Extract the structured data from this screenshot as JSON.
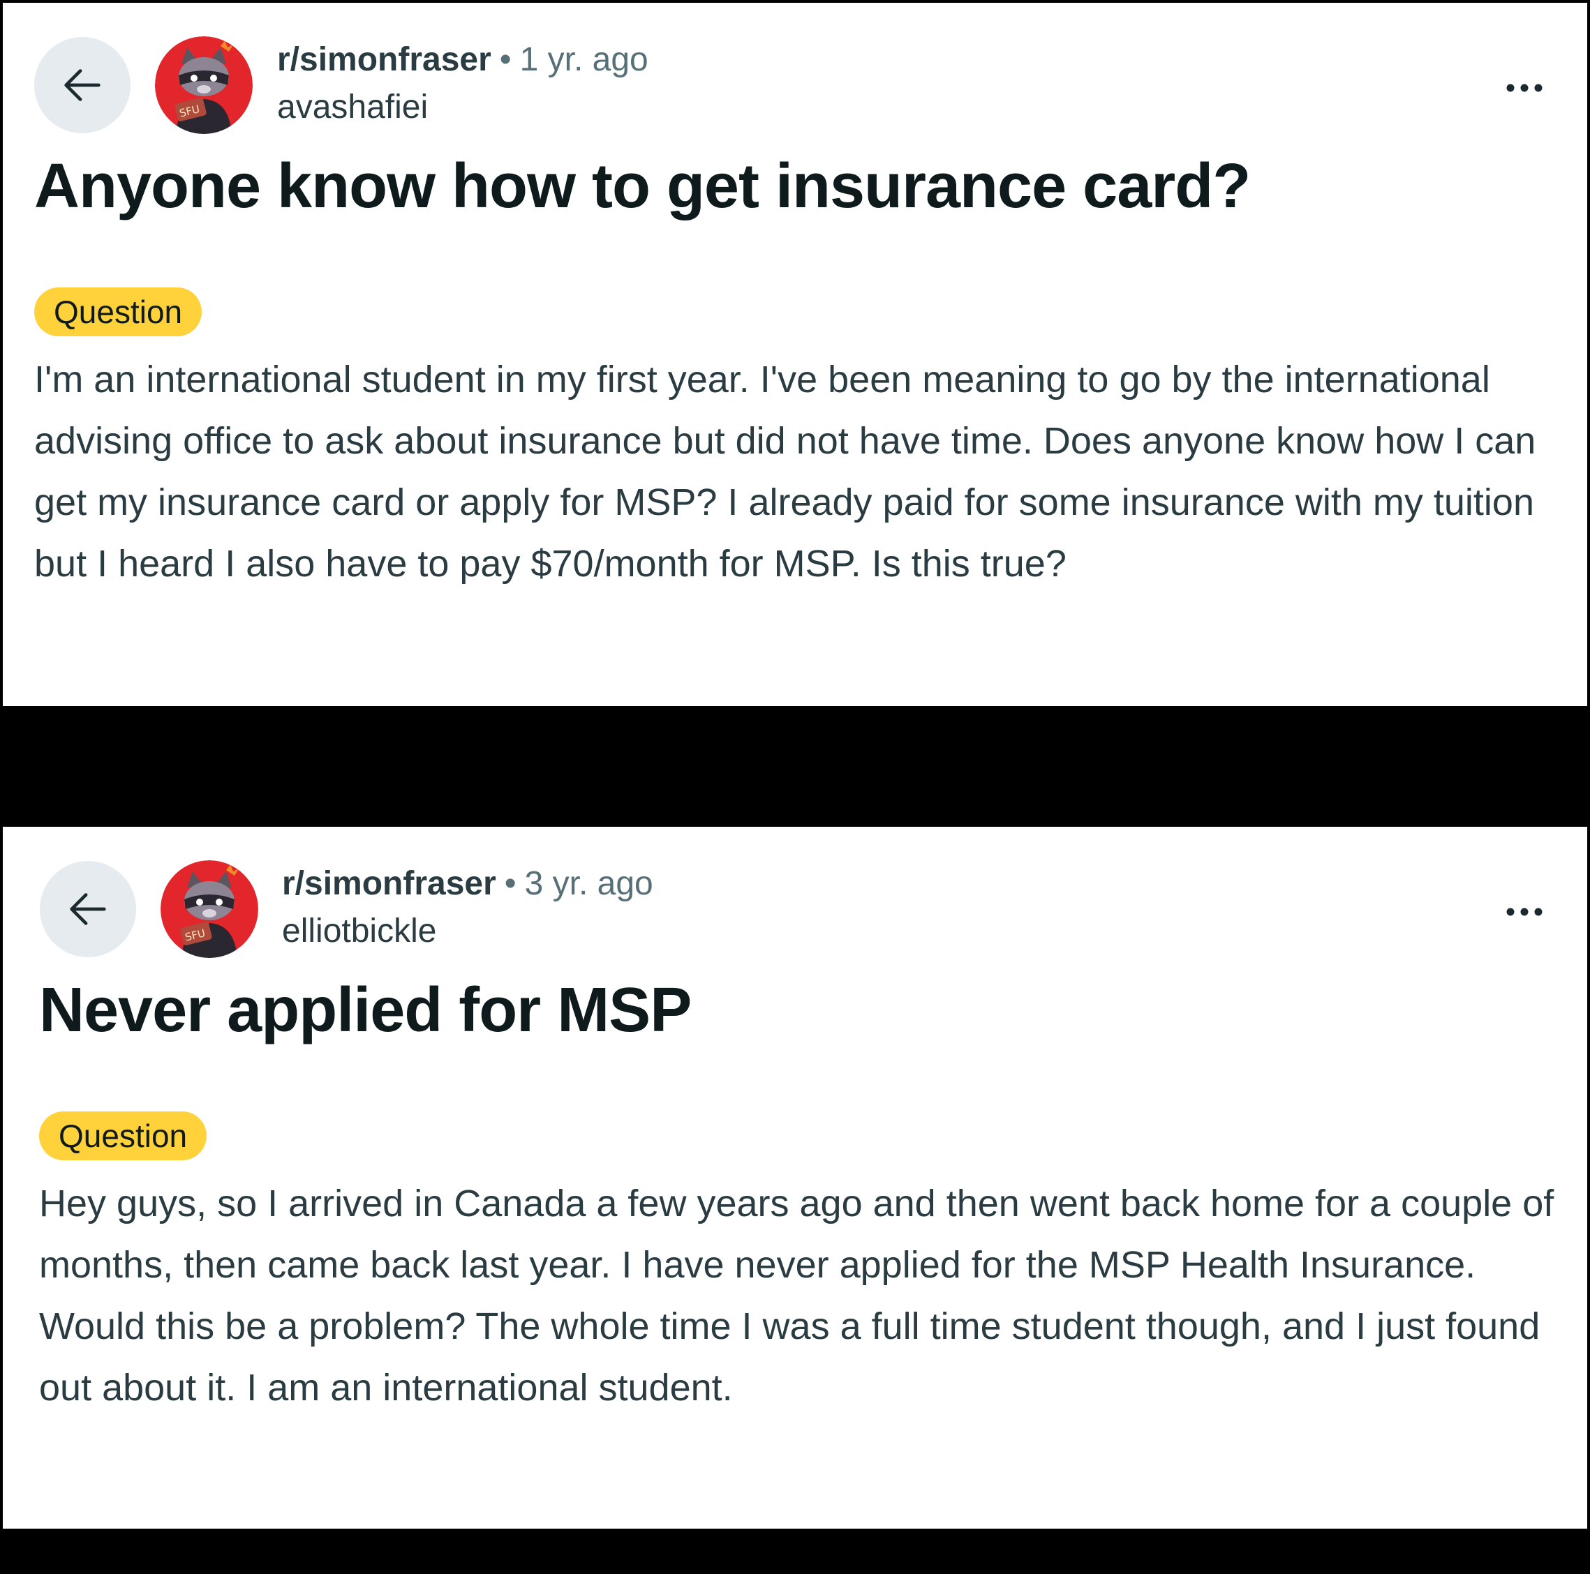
{
  "posts": [
    {
      "subreddit": "r/simonfraser",
      "separator": "•",
      "age": "1 yr. ago",
      "author": "avashafiei",
      "title": "Anyone know how to get insurance card?",
      "flair": "Question",
      "body": "I'm an international student in my first year. I've been meaning to go by the international advising office to ask about insurance but did not have time. Does anyone know how I can get my insurance card or apply for MSP? I already paid for some insurance with my tuition but I heard I also have to pay $70/month for MSP. Is this true?",
      "avatar_badge": "SFU",
      "icons": {
        "back": "arrow-left-icon",
        "more": "ellipsis-icon"
      }
    },
    {
      "subreddit": "r/simonfraser",
      "separator": "•",
      "age": "3 yr. ago",
      "author": "elliotbickle",
      "title": "Never applied for MSP",
      "flair": "Question",
      "body": "Hey guys, so I arrived in Canada a few years ago and then went back home for a couple of months, then came back last year. I have never applied for the MSP Health Insurance. Would this be a problem? The whole time I was a full time student though, and I just found out about it. I am an international student.",
      "avatar_badge": "SFU",
      "icons": {
        "back": "arrow-left-icon",
        "more": "ellipsis-icon"
      }
    }
  ],
  "colors": {
    "background": "#000000",
    "panel": "#ffffff",
    "flair": "#ffd23c",
    "back_button": "#e5ebee",
    "avatar_bg": "#e3262b",
    "title_text": "#0f1a1c",
    "body_text": "#2a3c42",
    "muted_text": "#576f76"
  }
}
